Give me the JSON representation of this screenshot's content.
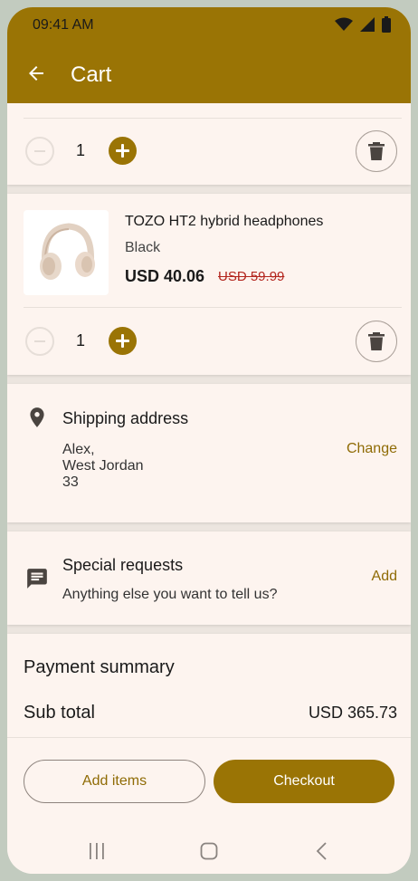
{
  "status_bar": {
    "time": "09:41 AM"
  },
  "app_bar": {
    "title": "Cart"
  },
  "cart_items": [
    {
      "quantity": "1"
    },
    {
      "name": "TOZO HT2 hybrid headphones",
      "variant": "Black",
      "price": "USD 40.06",
      "original_price": "USD 59.99",
      "quantity": "1"
    }
  ],
  "shipping": {
    "title": "Shipping address",
    "lines": [
      "Alex,",
      "West Jordan",
      "33"
    ],
    "action": "Change"
  },
  "special_requests": {
    "title": "Special requests",
    "subtitle": "Anything else you want to tell us?",
    "action": "Add"
  },
  "payment_summary": {
    "title": "Payment summary",
    "subtotal_label": "Sub total",
    "subtotal_value": "USD 365.73"
  },
  "actions": {
    "add_items": "Add items",
    "checkout": "Checkout"
  },
  "colors": {
    "primary": "#9a7405",
    "surface": "#fdf4ef",
    "strike_price": "#b3261e"
  }
}
